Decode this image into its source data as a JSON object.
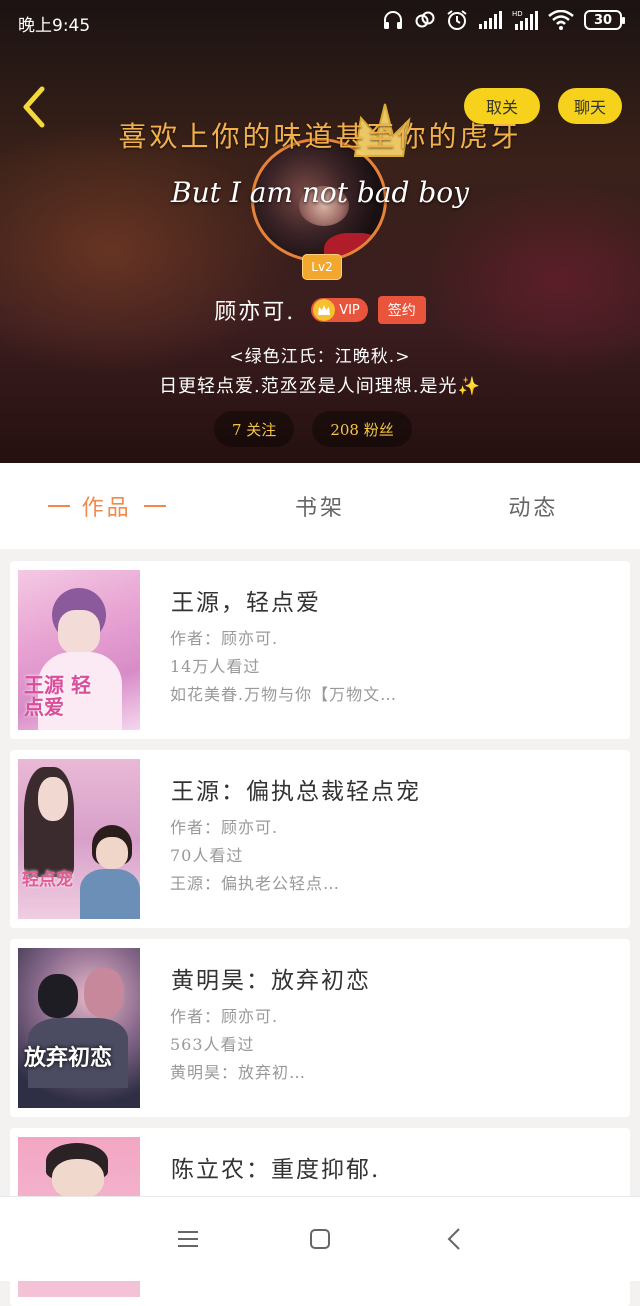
{
  "status_bar": {
    "time": "晚上9:45",
    "battery": "30",
    "icons": [
      "headphones-icon",
      "link-icon",
      "alarm-icon",
      "signal-icon",
      "hd-signal-icon",
      "wifi-icon",
      "battery-icon"
    ]
  },
  "header": {
    "back_icon": "chevron-left-icon",
    "unfollow_label": "取关",
    "chat_label": "聊天",
    "title": "喜欢上你的味道甚至你的虎牙",
    "subtitle": "But I am not bad boy",
    "level": "Lv2"
  },
  "profile": {
    "username": "顾亦可.",
    "vip_label": "VIP",
    "sign_label": "签约",
    "bio_line1": "<绿色江氏：江晚秋.>",
    "bio_line2": "日更轻点爱.范丞丞是人间理想.是光✨",
    "follow_stat": "7 关注",
    "fans_stat": "208 粉丝"
  },
  "tabs": [
    {
      "label": "作品",
      "active": true
    },
    {
      "label": "书架",
      "active": false
    },
    {
      "label": "动态",
      "active": false
    }
  ],
  "books": [
    {
      "title": "王源，轻点爱",
      "author": "作者：顾亦可.",
      "views": "14万人看过",
      "desc": "如花美眷.万物与你【万物文…",
      "cover_text": "王源 轻点爱"
    },
    {
      "title": "王源：偏执总裁轻点宠",
      "author": "作者：顾亦可.",
      "views": "70人看过",
      "desc": "王源：偏执老公轻点…",
      "cover_text": "轻点宠"
    },
    {
      "title": "黄明昊：放弃初恋",
      "author": "作者：顾亦可.",
      "views": "563人看过",
      "desc": "黄明昊：放弃初…",
      "cover_text": "放弃初恋"
    },
    {
      "title": "陈立农：重度抑郁.",
      "author": "",
      "views": "",
      "desc": "",
      "cover_text": ""
    }
  ],
  "nav": {
    "icons": [
      "menu-icon",
      "home-square-icon",
      "back-icon"
    ]
  },
  "colors": {
    "accent": "#f08a4b",
    "pill_yellow": "#f6d21c",
    "title_gold": "#f1b04a",
    "badge_red": "#e8553c"
  }
}
